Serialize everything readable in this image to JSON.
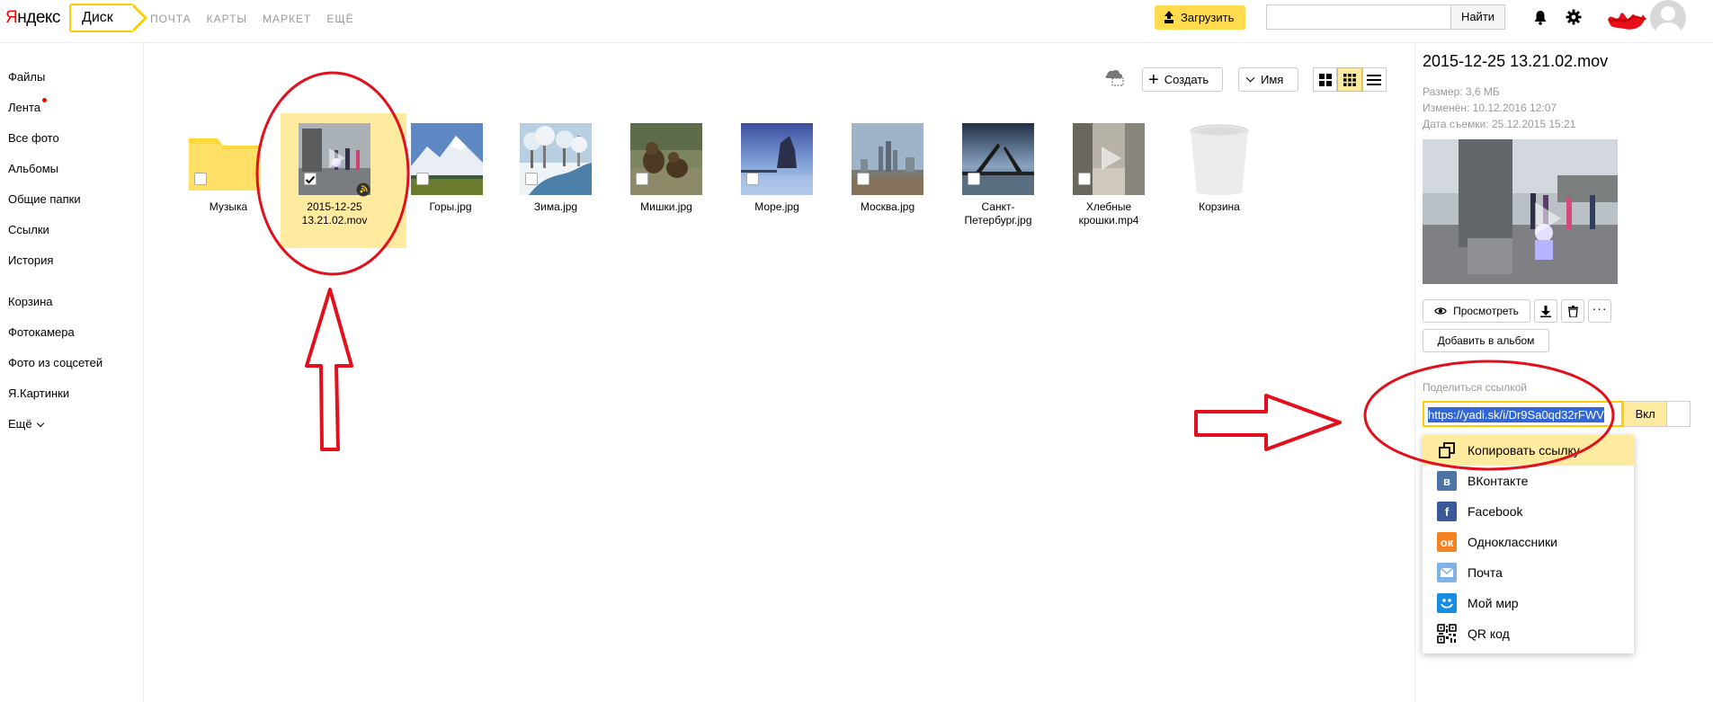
{
  "header": {
    "logo_prefix": "Я",
    "logo_rest": "ндекс",
    "service_tab": "Диск",
    "nav": [
      "ПОЧТА",
      "КАРТЫ",
      "МАРКЕТ",
      "ЕЩЁ"
    ],
    "upload_label": "Загрузить",
    "search_placeholder": "",
    "search_button": "Найти",
    "accent_color": "#ffdb4d"
  },
  "sidebar": {
    "items": [
      {
        "label": "Файлы"
      },
      {
        "label": "Лента",
        "badge": true
      },
      {
        "label": "Все фото"
      },
      {
        "label": "Альбомы"
      },
      {
        "label": "Общие папки"
      },
      {
        "label": "Ссылки"
      },
      {
        "label": "История"
      }
    ],
    "items2": [
      {
        "label": "Корзина"
      },
      {
        "label": "Фотокамера"
      },
      {
        "label": "Фото из соцсетей"
      },
      {
        "label": "Я.Картинки"
      },
      {
        "label": "Ещё"
      }
    ]
  },
  "toolbar": {
    "create_label": "Создать",
    "sort_label": "Имя",
    "active_view": "grid-small"
  },
  "files": [
    {
      "name": "Музыка",
      "type": "folder"
    },
    {
      "name": "2015-12-25 13.21.02.mov",
      "name_line1": "2015-12-25",
      "name_line2": "13.21.02.mov",
      "type": "video",
      "selected": true,
      "shared": true
    },
    {
      "name": "Горы.jpg",
      "type": "image"
    },
    {
      "name": "Зима.jpg",
      "type": "image"
    },
    {
      "name": "Мишки.jpg",
      "type": "image"
    },
    {
      "name": "Море.jpg",
      "type": "image"
    },
    {
      "name": "Москва.jpg",
      "type": "image"
    },
    {
      "name": "Санкт-Петербург.jpg",
      "name_line1": "Санкт-",
      "name_line2": "Петербург.jpg",
      "type": "image"
    },
    {
      "name": "Хлебные крошки.mp4",
      "name_line1": "Хлебные",
      "name_line2": "крошки.mp4",
      "type": "video"
    },
    {
      "name": "Корзина",
      "type": "trash"
    }
  ],
  "details": {
    "title": "2015-12-25 13.21.02.mov",
    "size": "Размер: 3,6 МБ",
    "modified": "Изменён: 10.12.2016 12:07",
    "shot": "Дата съемки: 25.12.2015 15:21",
    "view_button": "Просмотреть",
    "add_album_button": "Добавить в альбом",
    "share_label": "Поделиться ссылкой",
    "share_link": "https://yadi.sk/i/Dr9Sa0qd32rFWV",
    "toggle_label": "Вкл",
    "share_menu": [
      {
        "label": "Копировать ссылку",
        "icon": "copy-icon",
        "highlighted": true
      },
      {
        "label": "ВКонтакте",
        "icon": "vk-icon",
        "color": "#4c75a3"
      },
      {
        "label": "Facebook",
        "icon": "facebook-icon",
        "color": "#3b5998"
      },
      {
        "label": "Одноклассники",
        "icon": "ok-icon",
        "color": "#f58220"
      },
      {
        "label": "Почта",
        "icon": "mail-icon",
        "color": "#7fb2e5"
      },
      {
        "label": "Мой мир",
        "icon": "moimir-icon",
        "color": "#168de2"
      },
      {
        "label": "QR код",
        "icon": "qr-icon"
      }
    ]
  }
}
